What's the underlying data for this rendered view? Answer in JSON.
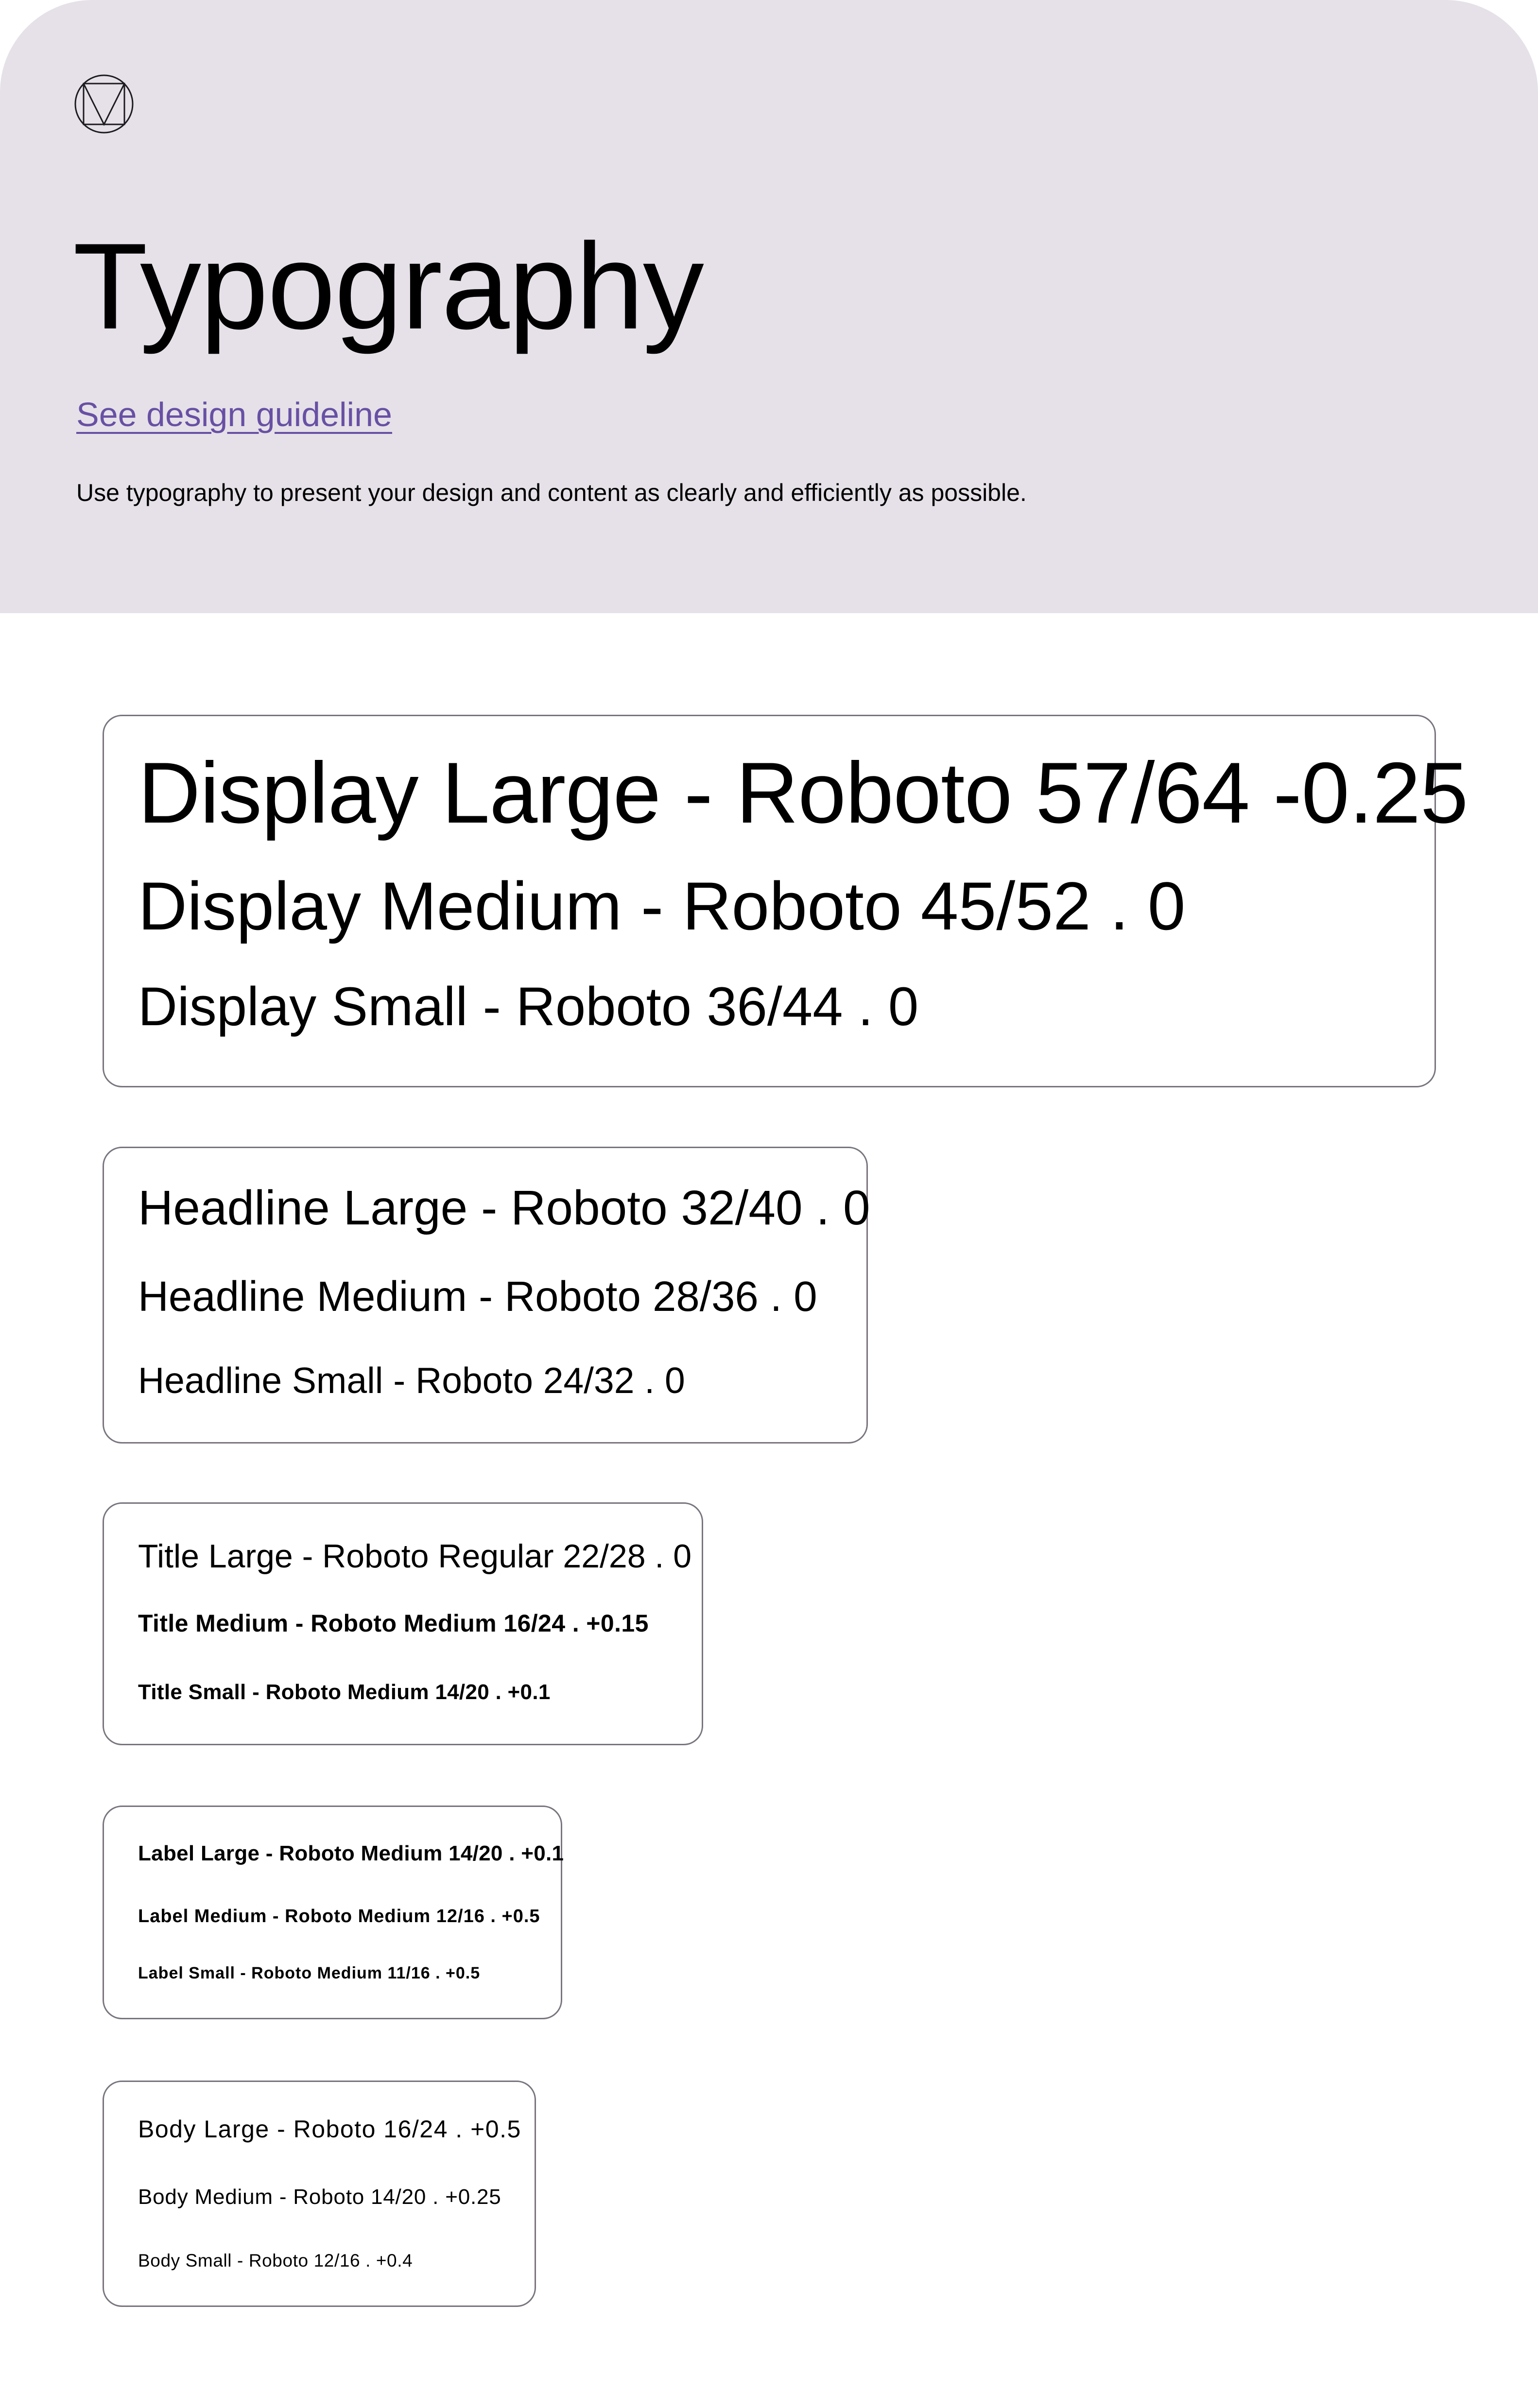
{
  "header": {
    "logo_icon": "material-logo-icon",
    "title": "Typography",
    "guideline_link": "See design guideline",
    "description": "Use typography to present your design and content as clearly and efficiently as possible.",
    "background_color": "#e6e1e8",
    "link_color": "#6750a4"
  },
  "scales": {
    "display": [
      "Display Large - Roboto 57/64 -0.25",
      "Display Medium - Roboto 45/52 .  0",
      "Display Small - Roboto 36/44 . 0"
    ],
    "headline": [
      "Headline Large - Roboto 32/40 . 0",
      "Headline Medium - Roboto 28/36 . 0",
      "Headline Small - Roboto 24/32 . 0"
    ],
    "title": [
      "Title Large - Roboto Regular 22/28 . 0",
      "Title Medium - Roboto Medium 16/24 . +0.15",
      "Title Small - Roboto Medium 14/20 . +0.1"
    ],
    "label": [
      "Label Large - Roboto Medium 14/20 . +0.1",
      "Label Medium - Roboto Medium 12/16 . +0.5",
      "Label Small - Roboto Medium 11/16 . +0.5"
    ],
    "body": [
      "Body Large - Roboto 16/24 . +0.5",
      "Body Medium - Roboto 14/20 . +0.25",
      "Body Small - Roboto 12/16 . +0.4"
    ]
  }
}
